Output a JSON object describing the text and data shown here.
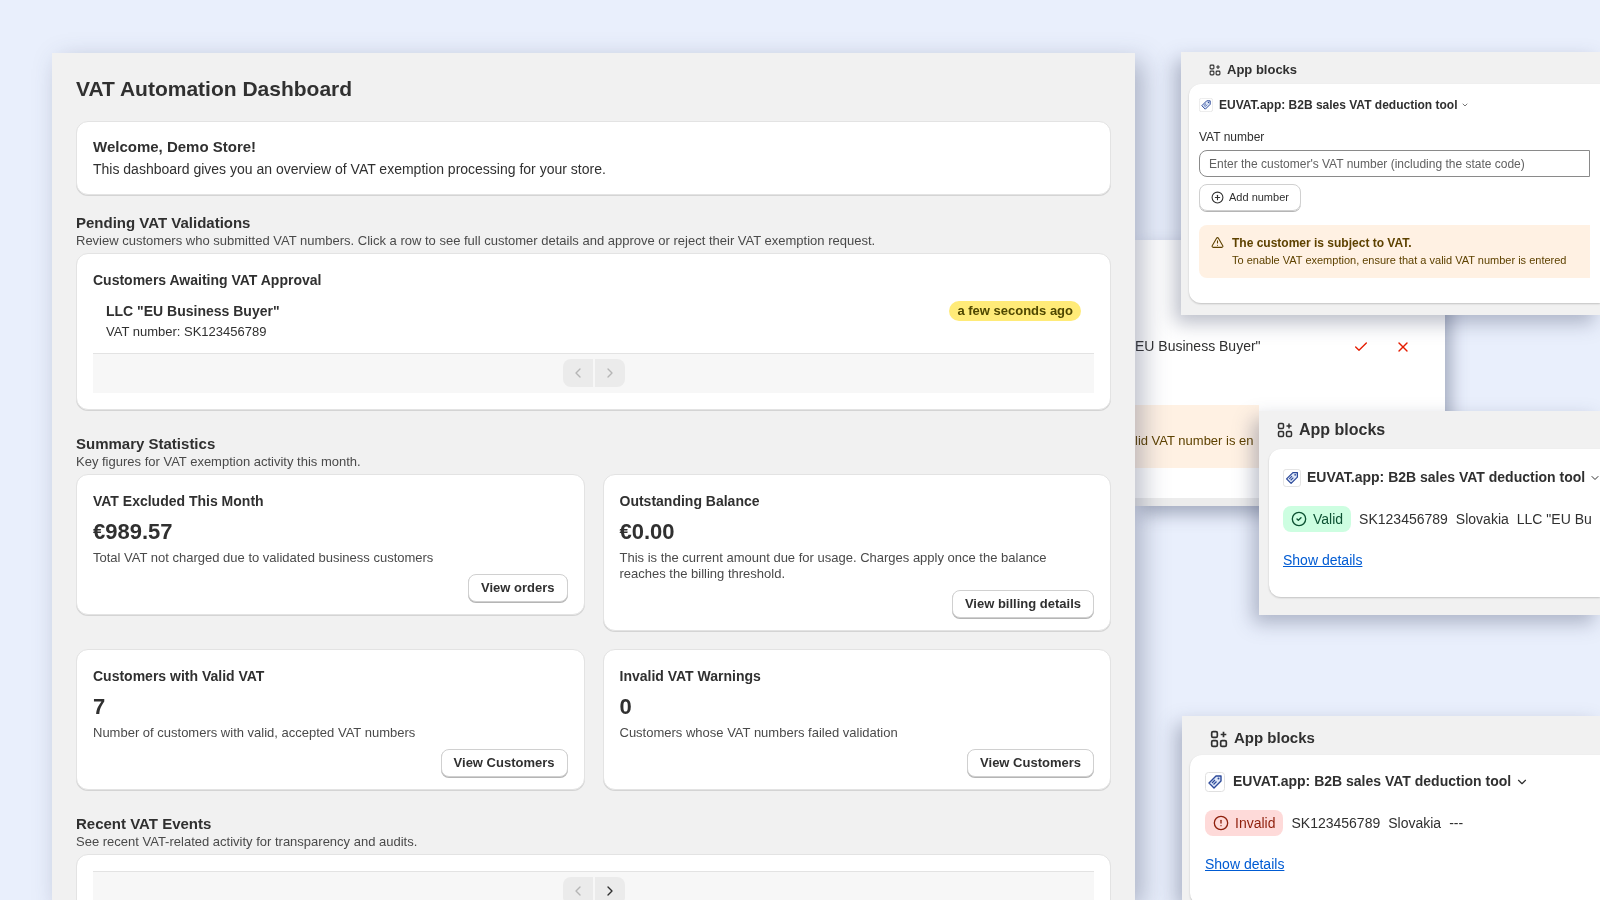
{
  "dashboard": {
    "title": "VAT Automation Dashboard",
    "welcome": {
      "title": "Welcome, Demo Store!",
      "text": "This dashboard gives you an overview of VAT exemption processing for your store."
    },
    "pending": {
      "title": "Pending VAT Validations",
      "description": "Review customers who submitted VAT numbers. Click a row to see full customer details and approve or reject their VAT exemption request.",
      "card_title": "Customers Awaiting VAT Approval",
      "customers": [
        {
          "name": "LLC \"EU Business Buyer\"",
          "vat": "VAT number: SK123456789",
          "time": "a few seconds ago"
        }
      ],
      "pager": [
        {
          "kind": "prev",
          "disabled": true
        },
        {
          "kind": "next",
          "disabled": true
        }
      ]
    },
    "summary": {
      "title": "Summary Statistics",
      "description": "Key figures for VAT exemption activity this month.",
      "stats": [
        {
          "title": "VAT Excluded This Month",
          "value": "€989.57",
          "description": "Total VAT not charged due to validated business customers",
          "button": "View orders"
        },
        {
          "title": "Outstanding Balance",
          "value": "€0.00",
          "description": "This is the current amount due for usage. Charges apply once the balance reaches the billing threshold.",
          "button": "View billing details"
        },
        {
          "title": "Customers with Valid VAT",
          "value": "7",
          "description": "Number of customers with valid, accepted VAT numbers",
          "button": "View Customers"
        },
        {
          "title": "Invalid VAT Warnings",
          "value": "0",
          "description": "Customers whose VAT numbers failed validation",
          "button": "View Customers"
        }
      ]
    },
    "recent": {
      "title": "Recent VAT Events",
      "description": "See recent VAT-related activity for transparency and audits.",
      "pager": [
        {
          "kind": "prev",
          "disabled": true
        },
        {
          "kind": "next",
          "disabled": false
        }
      ]
    }
  },
  "background_window": {
    "row_name": "EU Business Buyer\"",
    "alert_text": "lid VAT number is en"
  },
  "app_blocks": [
    {
      "kind": "form",
      "header": "App blocks",
      "app_name": "EUVAT.app: B2B sales VAT deduction tool",
      "field_label": "VAT number",
      "placeholder": "Enter the customer's VAT number (including the state code)",
      "button": "Add number",
      "alert": {
        "title": "The customer is subject to VAT.",
        "text": "To enable VAT exemption, ensure that a valid VAT number is entered"
      }
    },
    {
      "kind": "result",
      "header": "App blocks",
      "app_name": "EUVAT.app: B2B sales VAT deduction tool",
      "valid": true,
      "status_label": "Valid",
      "values": [
        "SK123456789",
        "Slovakia",
        "LLC \"EU Bu"
      ],
      "link": "Show details"
    },
    {
      "kind": "result",
      "header": "App blocks",
      "app_name": "EUVAT.app: B2B sales VAT deduction tool",
      "valid": false,
      "status_label": "Invalid",
      "values": [
        "SK123456789",
        "Slovakia",
        "---"
      ],
      "link": "Show details"
    }
  ]
}
